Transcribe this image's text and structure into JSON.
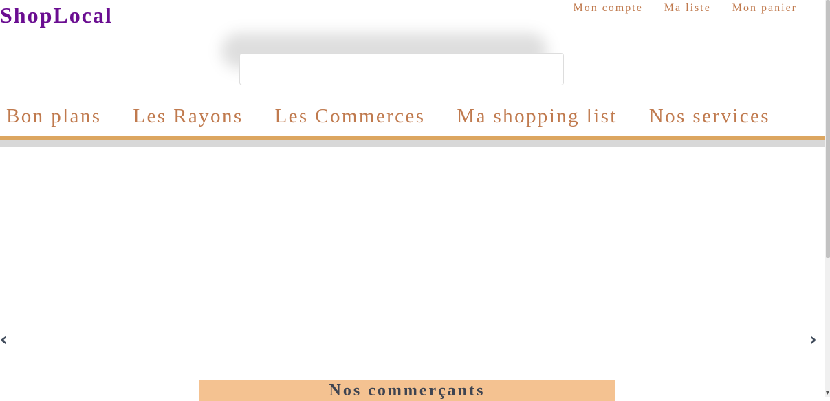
{
  "header": {
    "logo": "ShopLocal",
    "top_links": [
      "Mon compte",
      "Ma liste",
      "Mon panier"
    ]
  },
  "search": {
    "value": "",
    "placeholder": ""
  },
  "nav": {
    "items": [
      "Bon plans",
      "Les Rayons",
      "Les Commerces",
      "Ma shopping list",
      "Nos services"
    ]
  },
  "carousel": {
    "prev_icon": "‹",
    "next_icon": "›"
  },
  "section": {
    "title": "Nos commerçants"
  },
  "colors": {
    "logo": "#6a0d91",
    "links": "#c07a4e",
    "nav_bar": "#dca660",
    "section_bg": "#f4c291"
  }
}
